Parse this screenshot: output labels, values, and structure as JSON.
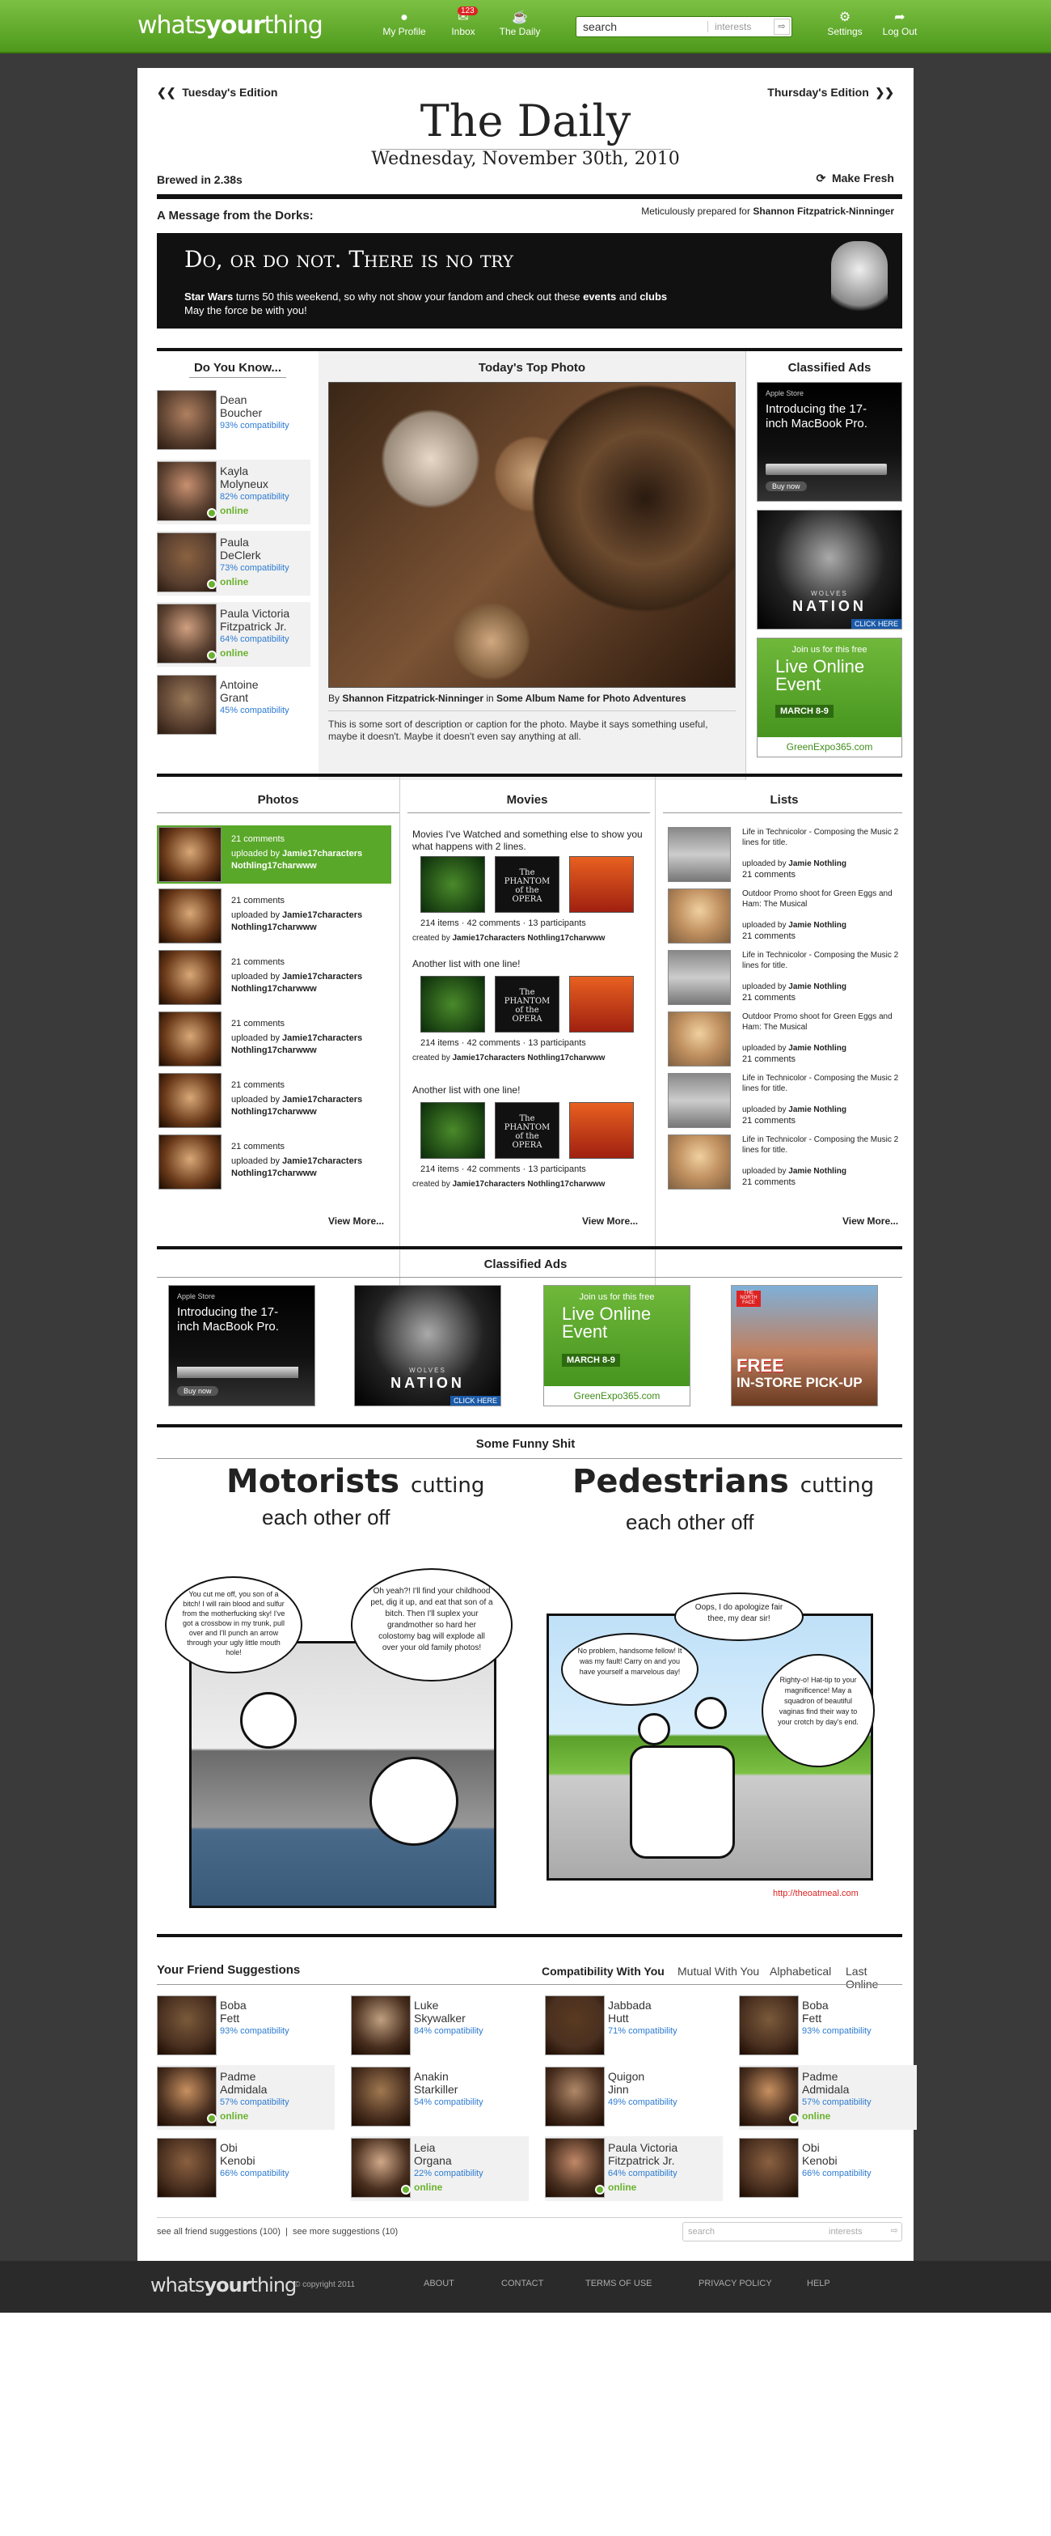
{
  "header": {
    "logo_pre": "whats",
    "logo_bold": "your",
    "logo_post": "thing",
    "nav": [
      {
        "label": "My Profile",
        "icon": "person-icon"
      },
      {
        "label": "Inbox",
        "icon": "mail-icon",
        "badge": "123"
      },
      {
        "label": "The Daily",
        "icon": "coffee-icon"
      }
    ],
    "search_placeholder": "search",
    "search_filter": "interests",
    "right_nav": [
      {
        "label": "Settings",
        "icon": "gear-icon"
      },
      {
        "label": "Log Out",
        "icon": "logout-icon"
      }
    ]
  },
  "daily": {
    "prev_edition": "Tuesday's Edition",
    "next_edition": "Thursday's Edition",
    "title": "The Daily",
    "date": "Wednesday, November 30th, 2010",
    "brewed": "Brewed in 2.38s",
    "make_fresh": "Make Fresh"
  },
  "message": {
    "title": "A Message from the Dorks:",
    "prepared_pre": "Meticulously prepared for",
    "prepared_name": "Shannon Fitzpatrick-Ninninger",
    "banner_title": "Do, or do not. There is no try",
    "banner_text_1": "Star Wars",
    "banner_text_2": " turns 50 this weekend, so why not show your fandom and check out these ",
    "banner_text_3": "events",
    "banner_text_4": " and ",
    "banner_text_5": "clubs",
    "banner_text_6": "May the force be with you!"
  },
  "do_you_know": {
    "title": "Do You Know...",
    "people": [
      {
        "name1": "Dean",
        "name2": "Boucher",
        "compat": "93% compatibility",
        "online": ""
      },
      {
        "name1": "Kayla",
        "name2": "Molyneux",
        "compat": "82% compatibility",
        "online": "online"
      },
      {
        "name1": "Paula",
        "name2": "DeClerk",
        "compat": "73% compatibility",
        "online": "online"
      },
      {
        "name1": "Paula Victoria",
        "name2": "Fitzpatrick Jr.",
        "compat": "64% compatibility",
        "online": "online"
      },
      {
        "name1": "Antoine",
        "name2": "Grant",
        "compat": "45% compatibility",
        "online": ""
      }
    ]
  },
  "top_photo": {
    "title": "Today's Top Photo",
    "by": "By ",
    "author": "Shannon Fitzpatrick-Ninninger",
    "in": " in ",
    "album": "Some Album Name for Photo Adventures",
    "caption": "This is some sort of description or caption for the photo.  Maybe it says something useful, maybe it doesn't.  Maybe it doesn't even say anything at all."
  },
  "classified": {
    "title": "Classified Ads",
    "apple_store": "Apple Store",
    "macbook": "Introducing the 17-inch MacBook Pro.",
    "buy_now": "Buy now",
    "wolves": "WOLVES",
    "nation": "NATION",
    "click_here": "CLICK HERE",
    "join": "Join us for this free",
    "live": "Live Online Event",
    "march": "MARCH 8-9",
    "expo": "GreenExpo365.com",
    "free": "FREE",
    "instore": "IN-STORE PICK-UP",
    "tnf": "THE NORTH FACE"
  },
  "photos": {
    "title": "Photos",
    "items": [
      {
        "comments": "21 comments",
        "uploaded": "uploaded by",
        "user": "Jamie17characters",
        "user2": "Nothling17charwww"
      },
      {
        "comments": "21 comments",
        "uploaded": "uploaded by",
        "user": "Jamie17characters",
        "user2": "Nothling17charwww"
      },
      {
        "comments": "21 comments",
        "uploaded": "uploaded by",
        "user": "Jamie17characters",
        "user2": "Nothling17charwww"
      },
      {
        "comments": "21 comments",
        "uploaded": "uploaded by",
        "user": "Jamie17characters",
        "user2": "Nothling17charwww"
      },
      {
        "comments": "21 comments",
        "uploaded": "uploaded by",
        "user": "Jamie17characters",
        "user2": "Nothling17charwww"
      },
      {
        "comments": "21 comments",
        "uploaded": "uploaded by",
        "user": "Jamie17characters",
        "user2": "Nothling17charwww"
      }
    ],
    "view_more": "View More..."
  },
  "movies": {
    "title": "Movies",
    "lists": [
      {
        "name": "Movies I've Watched and something else to show you what happens with 2 lines.",
        "stats": "214 items  ·  42 comments  ·  13 participants",
        "created": "created by ",
        "user": "Jamie17characters Nothling17charwww"
      },
      {
        "name": "Another list with one line!",
        "stats": "214 items  ·  42 comments  ·  13 participants",
        "created": "created by ",
        "user": "Jamie17characters Nothling17charwww"
      },
      {
        "name": "Another list with one line!",
        "stats": "214 items  ·  42 comments  ·  13 participants",
        "created": "created by ",
        "user": "Jamie17characters Nothling17charwww"
      }
    ],
    "phantom": "The PHANTOM of the OPERA",
    "view_more": "View More..."
  },
  "lists": {
    "title": "Lists",
    "items": [
      {
        "title": "Life in Technicolor - Composing the Music 2 lines for title.",
        "by": "uploaded by ",
        "user": "Jamie Nothling",
        "comments": "21 comments"
      },
      {
        "title": "Outdoor Promo shoot for Green Eggs and Ham: The Musical",
        "by": "uploaded by ",
        "user": "Jamie Nothling",
        "comments": "21 comments"
      },
      {
        "title": "Life in Technicolor - Composing the Music 2 lines for title.",
        "by": "uploaded by ",
        "user": "Jamie Nothling",
        "comments": "21 comments"
      },
      {
        "title": "Outdoor Promo shoot for Green Eggs and Ham: The Musical",
        "by": "uploaded by ",
        "user": "Jamie Nothling",
        "comments": "21 comments"
      },
      {
        "title": "Life in Technicolor - Composing the Music 2 lines for title.",
        "by": "uploaded by ",
        "user": "Jamie Nothling",
        "comments": "21 comments"
      },
      {
        "title": "Life in Technicolor - Composing the Music 2 lines for title.",
        "by": "uploaded by ",
        "user": "Jamie Nothling",
        "comments": "21 comments"
      }
    ],
    "view_more": "View More..."
  },
  "funny": {
    "title": "Some Funny Shit",
    "left_title_a": "Motorists",
    "left_title_b": "cutting",
    "left_title_c": "each other off",
    "right_title_a": "Pedestrians",
    "right_title_b": "cutting",
    "right_title_c": "each other off",
    "bubble1": "You cut me off, you son of a bitch! I will rain blood and sulfur from the motherfucking sky! I've got a crossbow in my trunk, pull over and I'll punch an arrow through your ugly little mouth hole!",
    "bubble2": "Oh yeah?! I'll find your childhood pet, dig it up, and eat that son of a bitch. Then I'll suplex your grandmother so hard her colostomy bag will explode all over your old family photos!",
    "bubble3": "Oops, I do apologize fair thee, my dear sir!",
    "bubble4": "No problem, handsome fellow! It was my fault! Carry on and you have yourself a marvelous day!",
    "bubble5": "Righty-o! Hat-tip to your magnificence! May a squadron of beautiful vaginas find their way to your crotch by day's end.",
    "credit": "http://theoatmeal.com"
  },
  "suggestions": {
    "title": "Your Friend Suggestions",
    "tabs": [
      "Compatibility With You",
      "Mutual With You",
      "Alphabetical",
      "Last Online"
    ],
    "people": [
      {
        "name1": "Boba",
        "name2": "Fett",
        "compat": "93% compatibility",
        "online": ""
      },
      {
        "name1": "Luke",
        "name2": "Skywalker",
        "compat": "84% compatibility",
        "online": ""
      },
      {
        "name1": "Jabbada",
        "name2": "Hutt",
        "compat": "71% compatibility",
        "online": ""
      },
      {
        "name1": "Boba",
        "name2": "Fett",
        "compat": "93% compatibility",
        "online": ""
      },
      {
        "name1": "Padme",
        "name2": "Admidala",
        "compat": "57% compatibility",
        "online": "online"
      },
      {
        "name1": "Anakin",
        "name2": "Starkiller",
        "compat": "54% compatibility",
        "online": ""
      },
      {
        "name1": "Quigon",
        "name2": "Jinn",
        "compat": "49% compatibility",
        "online": ""
      },
      {
        "name1": "Padme",
        "name2": "Admidala",
        "compat": "57% compatibility",
        "online": "online"
      },
      {
        "name1": "Obi",
        "name2": "Kenobi",
        "compat": "66% compatibility",
        "online": ""
      },
      {
        "name1": "Leia",
        "name2": "Organa",
        "compat": "22% compatibility",
        "online": "online"
      },
      {
        "name1": "Paula Victoria",
        "name2": "Fitzpatrick Jr.",
        "compat": "64% compatibility",
        "online": "online"
      },
      {
        "name1": "Obi",
        "name2": "Kenobi",
        "compat": "66% compatibility",
        "online": ""
      }
    ],
    "see_all": "see all friend suggestions (100)",
    "sep": "|",
    "see_more": "see more suggestions (10)",
    "search_placeholder": "search",
    "search_filter": "interests"
  },
  "footer": {
    "copyright": "© copyright 2011",
    "links": [
      "ABOUT",
      "CONTACT",
      "TERMS OF USE",
      "PRIVACY POLICY",
      "HELP"
    ]
  }
}
